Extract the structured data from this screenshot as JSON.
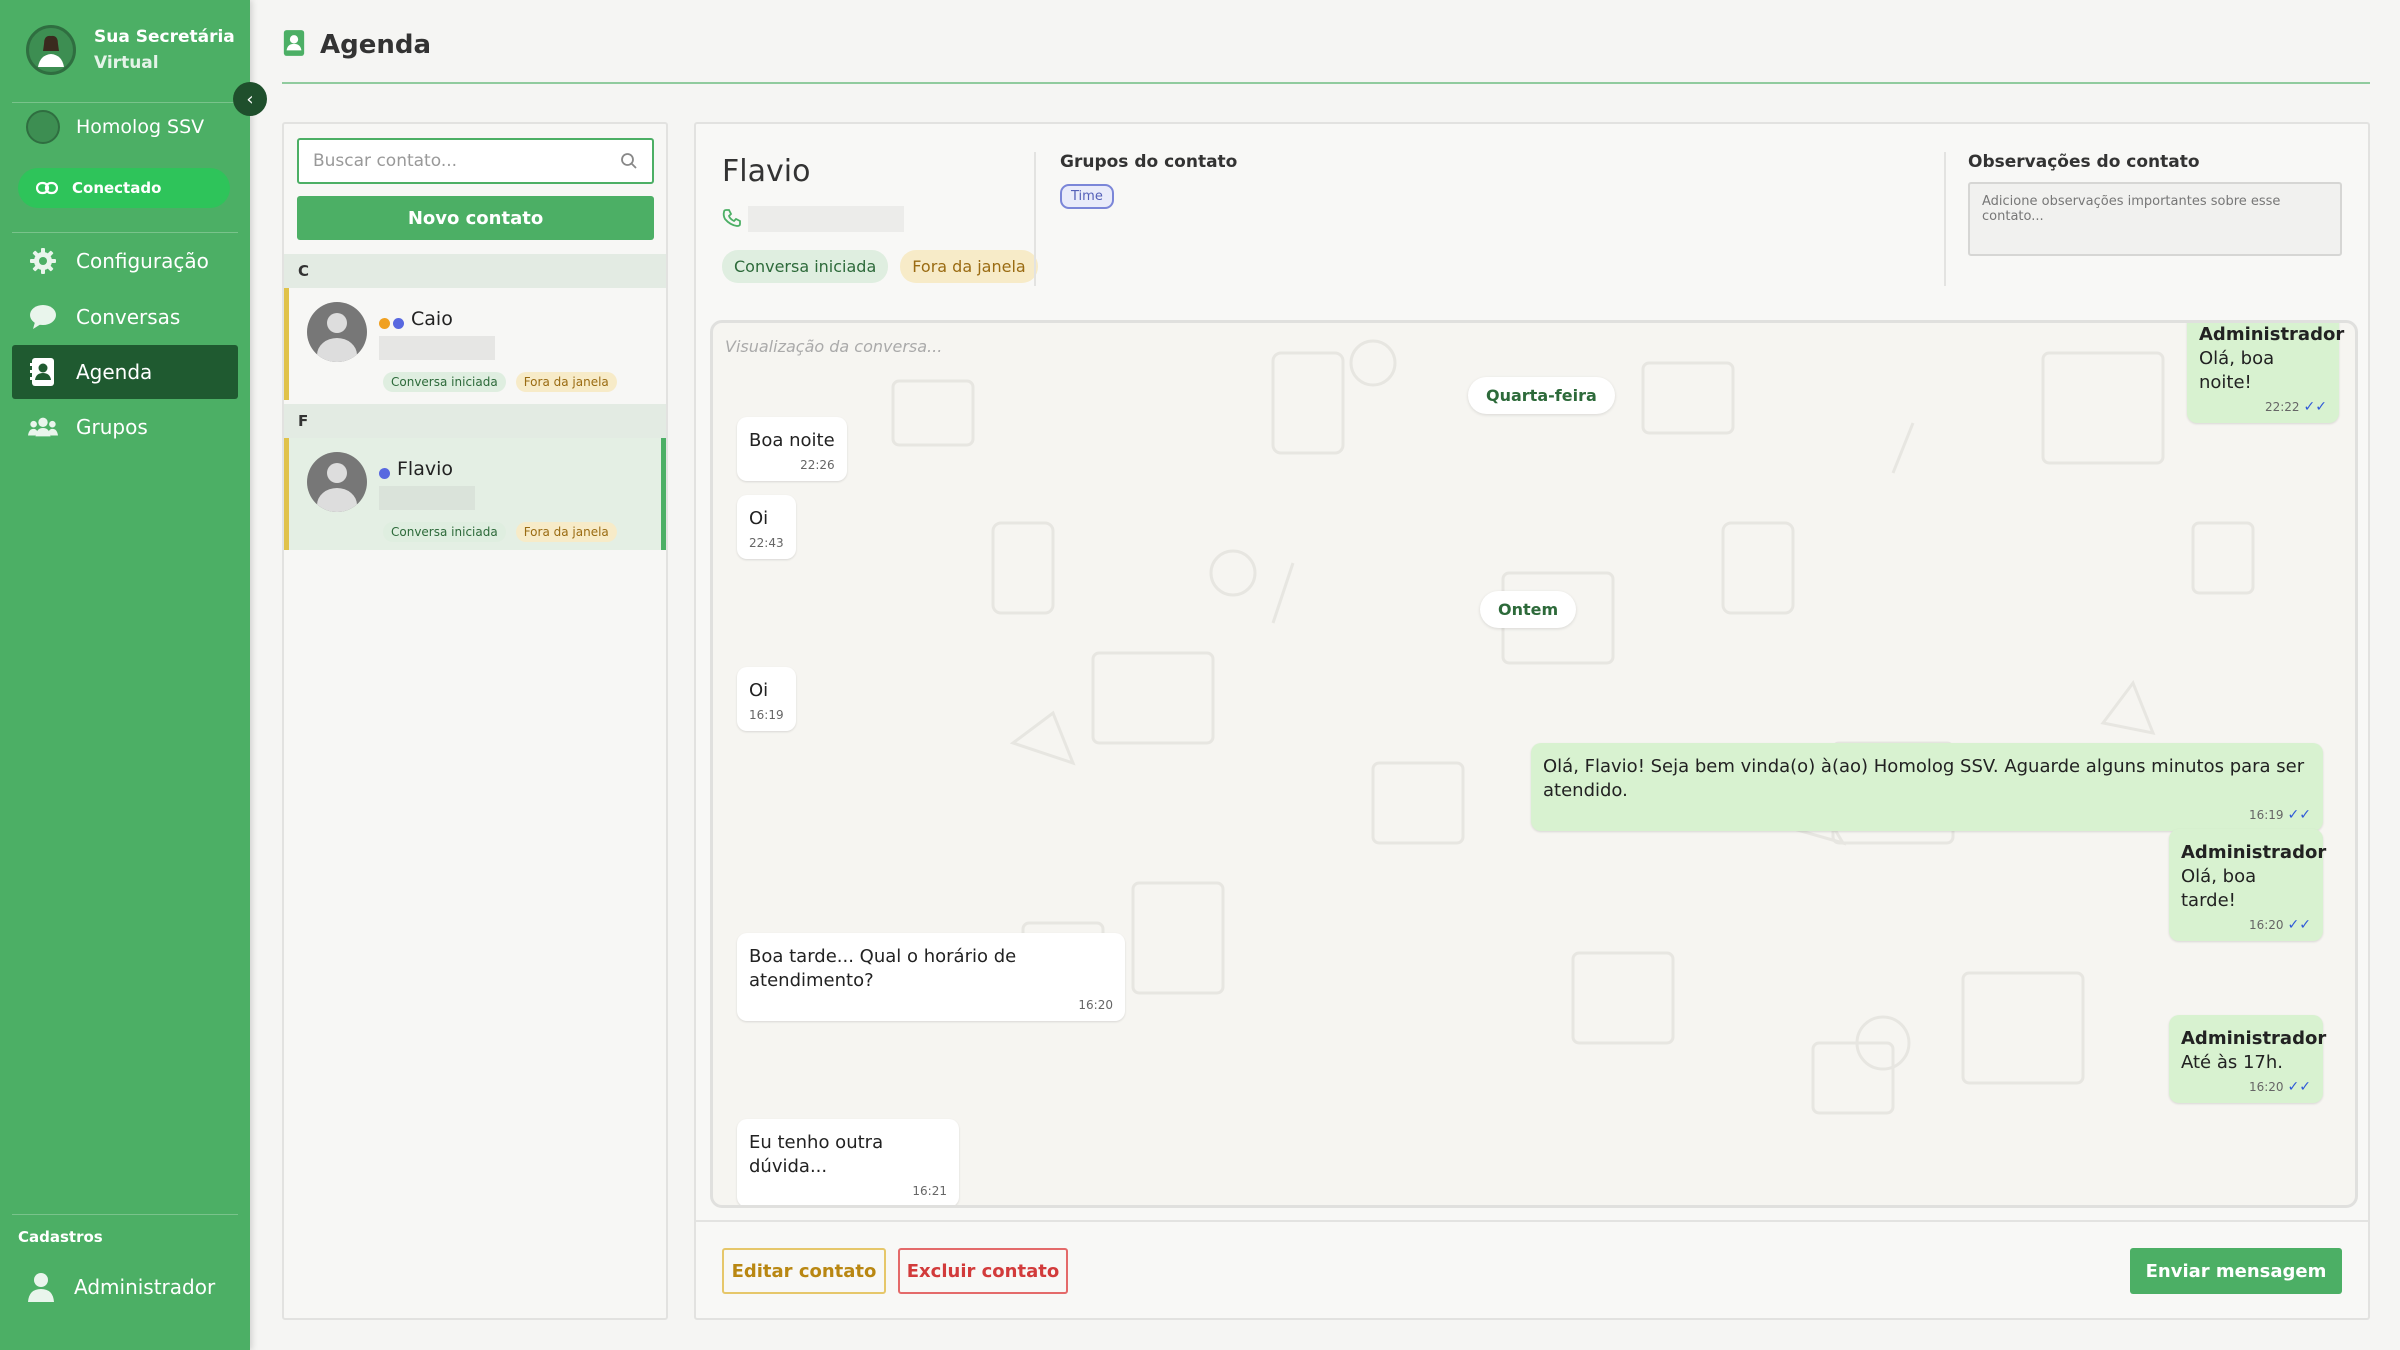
{
  "sidebar": {
    "brand_line1": "Sua Secretária",
    "brand_line2": "Virtual",
    "instance_name": "Homolog SSV",
    "connection_status": "Conectado",
    "items": [
      {
        "label": "Configuração",
        "icon": "gear-icon"
      },
      {
        "label": "Conversas",
        "icon": "chat-bubble-icon"
      },
      {
        "label": "Agenda",
        "icon": "contact-book-icon",
        "active": true
      },
      {
        "label": "Grupos",
        "icon": "users-icon"
      }
    ],
    "section_title": "Cadastros",
    "admin_label": "Administrador"
  },
  "header": {
    "title": "Agenda",
    "icon": "contact-book-icon"
  },
  "contacts": {
    "search_placeholder": "Buscar contato...",
    "new_button": "Novo contato",
    "groups": [
      {
        "letter": "C",
        "contacts": [
          {
            "name": "Caio",
            "tags": [
              "Conversa iniciada",
              "Fora da janela"
            ]
          }
        ]
      },
      {
        "letter": "F",
        "contacts": [
          {
            "name": "Flavio",
            "tags": [
              "Conversa iniciada",
              "Fora da janela"
            ],
            "selected": true
          }
        ]
      }
    ]
  },
  "detail": {
    "name": "Flavio",
    "tags": [
      "Conversa iniciada",
      "Fora da janela"
    ],
    "groups_title": "Grupos do contato",
    "group_chip": "Time",
    "obs_title": "Observações do contato",
    "obs_placeholder": "Adicione observações importantes sobre esse contato...",
    "chat_placeholder": "Visualização da conversa...",
    "edit_button": "Editar contato",
    "delete_button": "Excluir contato",
    "send_button": "Enviar mensagem"
  },
  "chat": {
    "day_wed": "Quarta-feira",
    "day_yesterday": "Ontem",
    "messages": [
      {
        "dir": "out",
        "author": "Administrador",
        "text": "Olá, boa noite!",
        "time": "22:22"
      },
      {
        "dir": "in",
        "text": "Boa noite",
        "time": "22:26"
      },
      {
        "dir": "in",
        "text": "Oi",
        "time": "22:43"
      },
      {
        "dir": "in",
        "text": "Oi",
        "time": "16:19"
      },
      {
        "dir": "out",
        "text": "Olá, Flavio! Seja bem vinda(o) à(ao) Homolog SSV. Aguarde alguns minutos para ser atendido.",
        "time": "16:19"
      },
      {
        "dir": "out",
        "author": "Administrador",
        "text": "Olá, boa tarde!",
        "time": "16:20"
      },
      {
        "dir": "in",
        "text": "Boa tarde... Qual o horário de atendimento?",
        "time": "16:20"
      },
      {
        "dir": "out",
        "author": "Administrador",
        "text": "Até às 17h.",
        "time": "16:20"
      },
      {
        "dir": "in",
        "text": "Eu tenho outra dúvida...",
        "time": "16:21"
      }
    ]
  },
  "colors": {
    "primary": "#4caf65",
    "primary_dark": "#1f5a30",
    "status_dot_orange": "#f0a020",
    "status_dot_blue": "#5868e0"
  }
}
